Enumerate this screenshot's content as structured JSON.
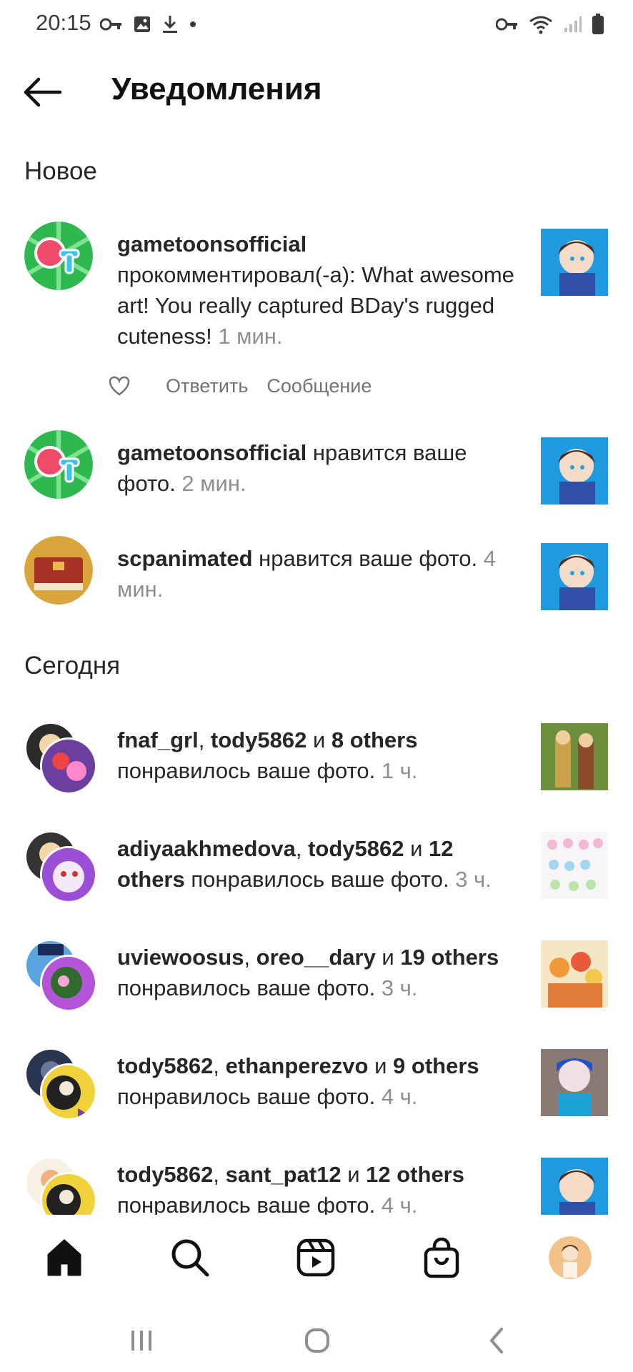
{
  "status_bar": {
    "time": "20:15",
    "left_icons": [
      "key-icon",
      "image-icon",
      "download-icon",
      "dot-icon"
    ],
    "right_icons": [
      "key-icon",
      "wifi-icon",
      "signal-icon",
      "battery-icon"
    ]
  },
  "header": {
    "title": "Уведомления"
  },
  "sections": {
    "new_title": "Новое",
    "today_title": "Сегодня"
  },
  "notifications": [
    {
      "user": "gametoonsofficial",
      "action": " прокомментировал(-а): What awesome art! You really captured BDay's rugged cuteness!",
      "time": " 1 мин.",
      "reply_label": "Ответить",
      "message_label": "Сообщение"
    },
    {
      "user": "gametoonsofficial",
      "action": " нравится ваше фото.",
      "time": " 2 мин."
    },
    {
      "user": "scpanimated",
      "action": " нравится ваше фото.",
      "time": " 4 мин."
    },
    {
      "user1": "fnaf_grl",
      "sep": ", ",
      "user2": "tody5862",
      "and": " и ",
      "others": "8 others",
      "action": " понравилось ваше фото.",
      "time": " 1 ч."
    },
    {
      "user1": "adiyaakhmedova",
      "sep": ", ",
      "user2": "tody5862",
      "and": " и ",
      "others": "12 others",
      "action": " понравилось ваше фото.",
      "time": " 3 ч."
    },
    {
      "user1": "uviewoosus",
      "sep": ", ",
      "user2": "oreo__dary",
      "and": " и ",
      "others": "19 others",
      "action": " понравилось ваше фото.",
      "time": " 3 ч."
    },
    {
      "user1": "tody5862",
      "sep": ", ",
      "user2": "ethanperezvo",
      "and": " и ",
      "others": "9 others",
      "action": " понравилось ваше фото.",
      "time": " 4 ч."
    },
    {
      "user1": "tody5862",
      "sep": ", ",
      "user2": "sant_pat12",
      "and": " и ",
      "others": "12 others",
      "action": " понравилось ваше фото.",
      "time": " 4 ч."
    }
  ],
  "bottom_nav": [
    "home-icon",
    "search-icon",
    "reels-icon",
    "shop-icon",
    "profile-avatar"
  ],
  "system_nav": [
    "recents-icon",
    "home-circle-icon",
    "back-icon"
  ],
  "colors": {
    "accent": "#262626",
    "muted": "#8e8e8e",
    "thumb_bg": "#1e9be0"
  }
}
